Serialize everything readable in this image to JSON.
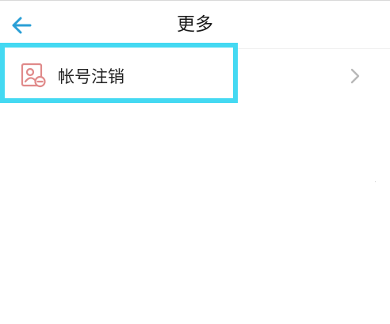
{
  "header": {
    "title": "更多",
    "back_icon": "arrow-left-icon"
  },
  "menu": {
    "items": [
      {
        "label": "帐号注销",
        "icon": "account-cancel-icon",
        "trailing_icon": "chevron-right-icon"
      }
    ]
  },
  "colors": {
    "accent": "#2a9fd6",
    "highlight": "#44d9f2",
    "icon": "#e08a8a",
    "chevron": "#b8b8b8",
    "text": "#222222"
  }
}
